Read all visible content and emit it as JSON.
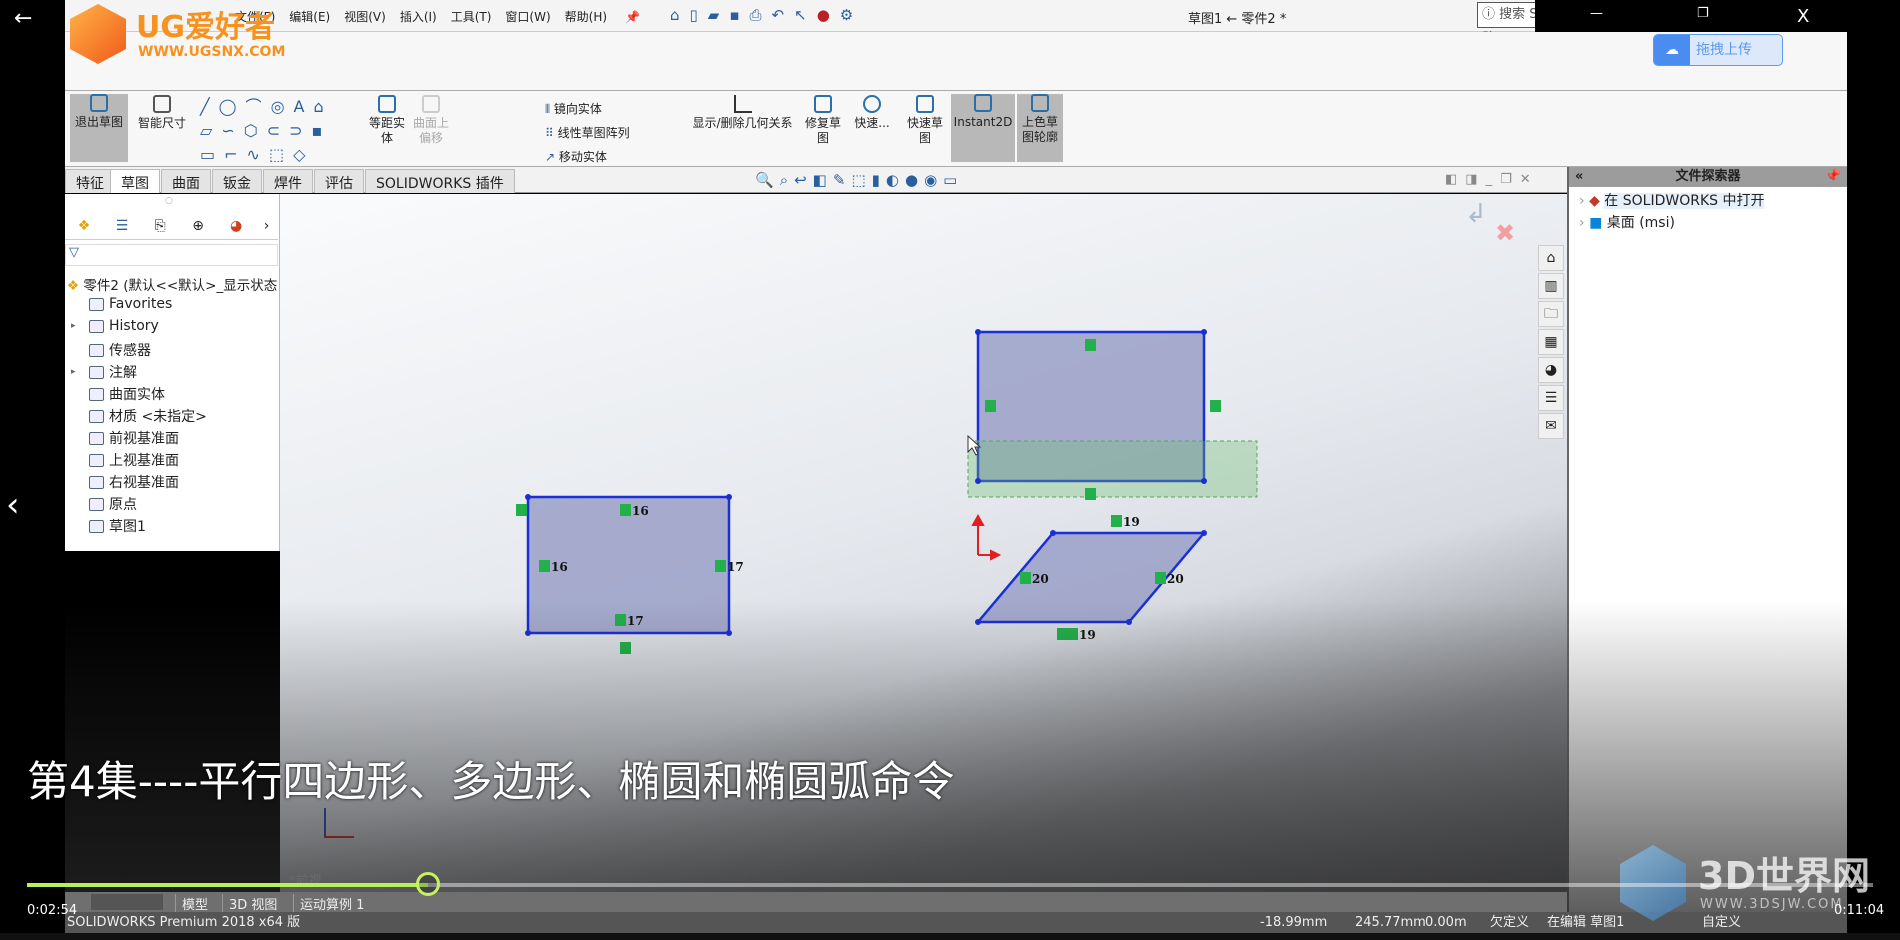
{
  "window": {
    "title": "草图1 ← 零件2 *",
    "search_placeholder": "搜索 SOLIDWORKS 帮助",
    "back_arrow": "←",
    "min": "—",
    "restore": "❐",
    "close": "X"
  },
  "logo": {
    "brand": "UG爱好者",
    "url": "WWW.UGSNX.COM",
    "app": "SOLIDWORKS"
  },
  "menu": [
    "文件(F)",
    "编辑(E)",
    "视图(V)",
    "插入(I)",
    "工具(T)",
    "窗口(W)",
    "帮助(H)"
  ],
  "upload_button": "拖拽上传",
  "commands": {
    "exit_sketch": "退出草图",
    "smart_dim": "智能尺寸",
    "offset_line1": "等距实",
    "offset_line2": "体",
    "surface_offset1": "曲面上",
    "surface_offset2": "偏移",
    "mirror": "镜向实体",
    "linear_pattern": "线性草图阵列",
    "move": "移动实体",
    "relations": "显示/删除几何关系",
    "repair1": "修复草",
    "repair2": "图",
    "quick_snaps": "快速...",
    "rapid1": "快速草",
    "rapid2": "图",
    "instant2d": "Instant2D",
    "shaded1": "上色草",
    "shaded2": "图轮廓"
  },
  "tabs": [
    "特征",
    "草图",
    "曲面",
    "钣金",
    "焊件",
    "评估",
    "SOLIDWORKS 插件"
  ],
  "active_tab": "草图",
  "tree": {
    "root": "零件2  (默认<<默认>_显示状态",
    "items": [
      "Favorites",
      "History",
      "传感器",
      "注解",
      "曲面实体",
      "材质 <未指定>",
      "前视基准面",
      "上视基准面",
      "右视基准面",
      "原点",
      "草图1"
    ]
  },
  "sketch": {
    "labels": [
      "16",
      "16",
      "17",
      "17",
      "19",
      "19",
      "20",
      "20"
    ]
  },
  "taskpane": {
    "title": "文件探索器",
    "items": [
      "在 SOLIDWORKS 中打开",
      "桌面 (msi)"
    ],
    "collapse": "«"
  },
  "view_label": "*前视",
  "bottom_tabs": [
    "模型",
    "3D 视图",
    "运动算例 1"
  ],
  "status": {
    "product": "SOLIDWORKS Premium 2018 x64 版",
    "x": "-18.99mm",
    "y": "245.77mm",
    "z": "0.00m",
    "defined": "欠定义",
    "editing": "在编辑 草图1",
    "units": "自定义"
  },
  "video": {
    "subtitle": "第4集----平行四边形、多边形、椭圆和椭圆弧命令",
    "current_time": "0:02:54",
    "total_time": "0:11:04",
    "progress_percent": 21.7,
    "accent": "#b8f05a"
  },
  "watermark": {
    "text": "3D世界网",
    "url": "WWW.3DSJW.COM"
  },
  "colors": {
    "sketch_line": "#1a2fd6",
    "sketch_fill": "#9aa0c8",
    "relation": "#22b04a",
    "origin": "#e02020"
  }
}
